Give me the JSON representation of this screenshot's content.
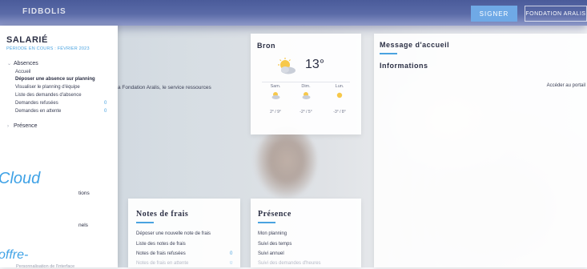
{
  "topbar": {
    "brand": "FIDBOLIS",
    "primary_button": "SIGNER",
    "org_button": "FONDATION ARALIS"
  },
  "sidebar": {
    "title": "SALARIÉ",
    "subtitle": "PÉRIODE EN COURS : FÉVRIER 2023",
    "section_absences": "Absences",
    "items": [
      {
        "label": "Accueil"
      },
      {
        "label": "Déposer une absence sur planning"
      },
      {
        "label": "Visualiser le planning d'équipe"
      },
      {
        "label": "Liste des demandes d'absence"
      },
      {
        "label": "Demandes refusées",
        "count": "0"
      },
      {
        "label": "Demandes en attente",
        "count": "0"
      }
    ],
    "section_presence": "Présence",
    "frag_1": "tions",
    "frag_2": "nels",
    "overlay_cloud": "Cloud",
    "overlay_offre": "offre-",
    "footer": "Personnalisation de l'interface"
  },
  "welcome_fragment": "a Fondation Aralis, le service ressources",
  "weather": {
    "city": "Bron",
    "temp": "13°",
    "days": [
      {
        "name": "Sam.",
        "range": "2° / 9°"
      },
      {
        "name": "Dim.",
        "range": "-2° / 5°"
      },
      {
        "name": "Lun.",
        "range": "-3° / 8°"
      }
    ]
  },
  "message": {
    "title": "Message d'accueil",
    "info": "Informations",
    "link": "Accéder au portail"
  },
  "notes": {
    "title": "Notes de frais",
    "links": [
      {
        "label": "Déposer une nouvelle note de frais"
      },
      {
        "label": "Liste des notes de frais"
      },
      {
        "label": "Notes de frais refusées",
        "count": "0"
      },
      {
        "label": "Notes de frais en attente",
        "count": "0"
      }
    ]
  },
  "presence": {
    "title": "Présence",
    "links": [
      {
        "label": "Mon planning"
      },
      {
        "label": "Suivi des temps"
      },
      {
        "label": "Suivi annuel"
      },
      {
        "label": "Suivi des demandes d'heures"
      }
    ]
  },
  "colors": {
    "accent": "#4aa3e0",
    "topbar": "#5b6ba8",
    "text": "#2b2f44"
  }
}
